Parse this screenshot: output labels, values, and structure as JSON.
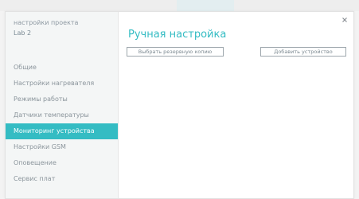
{
  "sidebar": {
    "title": "настройки проекта",
    "subtitle": "Lab 2",
    "items": [
      {
        "label": "Общие",
        "active": false
      },
      {
        "label": "Настройки нагревателя",
        "active": false
      },
      {
        "label": "Режимы работы",
        "active": false
      },
      {
        "label": "Датчики температуры",
        "active": false
      },
      {
        "label": "Мониторинг устройства",
        "active": true
      },
      {
        "label": "Настройки GSM",
        "active": false
      },
      {
        "label": "Оповещение",
        "active": false
      },
      {
        "label": "Сервис плат",
        "active": false
      }
    ]
  },
  "main": {
    "title": "Ручная настройка",
    "select_button_label": "Выбрать резервную копию",
    "add_button_label": "Добавить устройство"
  },
  "window": {
    "close_icon": "close-icon"
  },
  "colors": {
    "accent": "#34bcc3",
    "sidebar_bg": "#f4f6f6",
    "text_muted": "#8b959c"
  }
}
